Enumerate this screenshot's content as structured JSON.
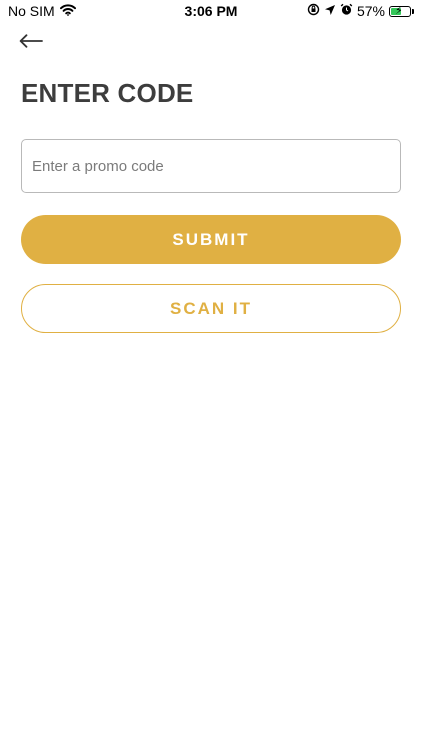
{
  "status_bar": {
    "carrier": "No SIM",
    "time": "3:06 PM",
    "battery_percent": "57%",
    "battery_level": 0.57,
    "icons": [
      "wifi-icon",
      "orientation-lock-icon",
      "location-arrow-icon",
      "alarm-icon",
      "battery-icon",
      "charging-bolt-icon"
    ]
  },
  "nav": {
    "back_icon": "arrow-left-icon"
  },
  "page": {
    "title": "ENTER CODE"
  },
  "promo": {
    "value": "",
    "placeholder": "Enter a promo code"
  },
  "actions": {
    "submit_label": "SUBMIT",
    "scan_label": "SCAN IT"
  },
  "colors": {
    "accent": "#E0B043",
    "title": "#3D3D3D",
    "battery_fill": "#34C759",
    "background": "#FFFFFF"
  }
}
